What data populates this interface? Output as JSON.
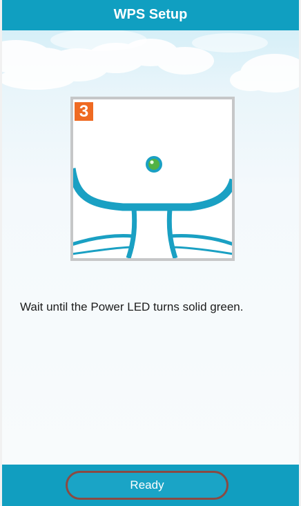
{
  "header": {
    "title": "WPS Setup"
  },
  "step": {
    "number": "3",
    "illustration_icon": "device-power-led-icon",
    "led_icon": "green-power-led-icon"
  },
  "instruction": {
    "text": "Wait until the Power LED turns solid green."
  },
  "footer": {
    "ready_label": "Ready"
  },
  "colors": {
    "header_bar": "#109fc1",
    "footer_bar": "#119ec0",
    "device_outline": "#1aa0c3",
    "led_green": "#52b244",
    "badge_orange": "#ef6a22",
    "button_border": "#8a4a43"
  }
}
